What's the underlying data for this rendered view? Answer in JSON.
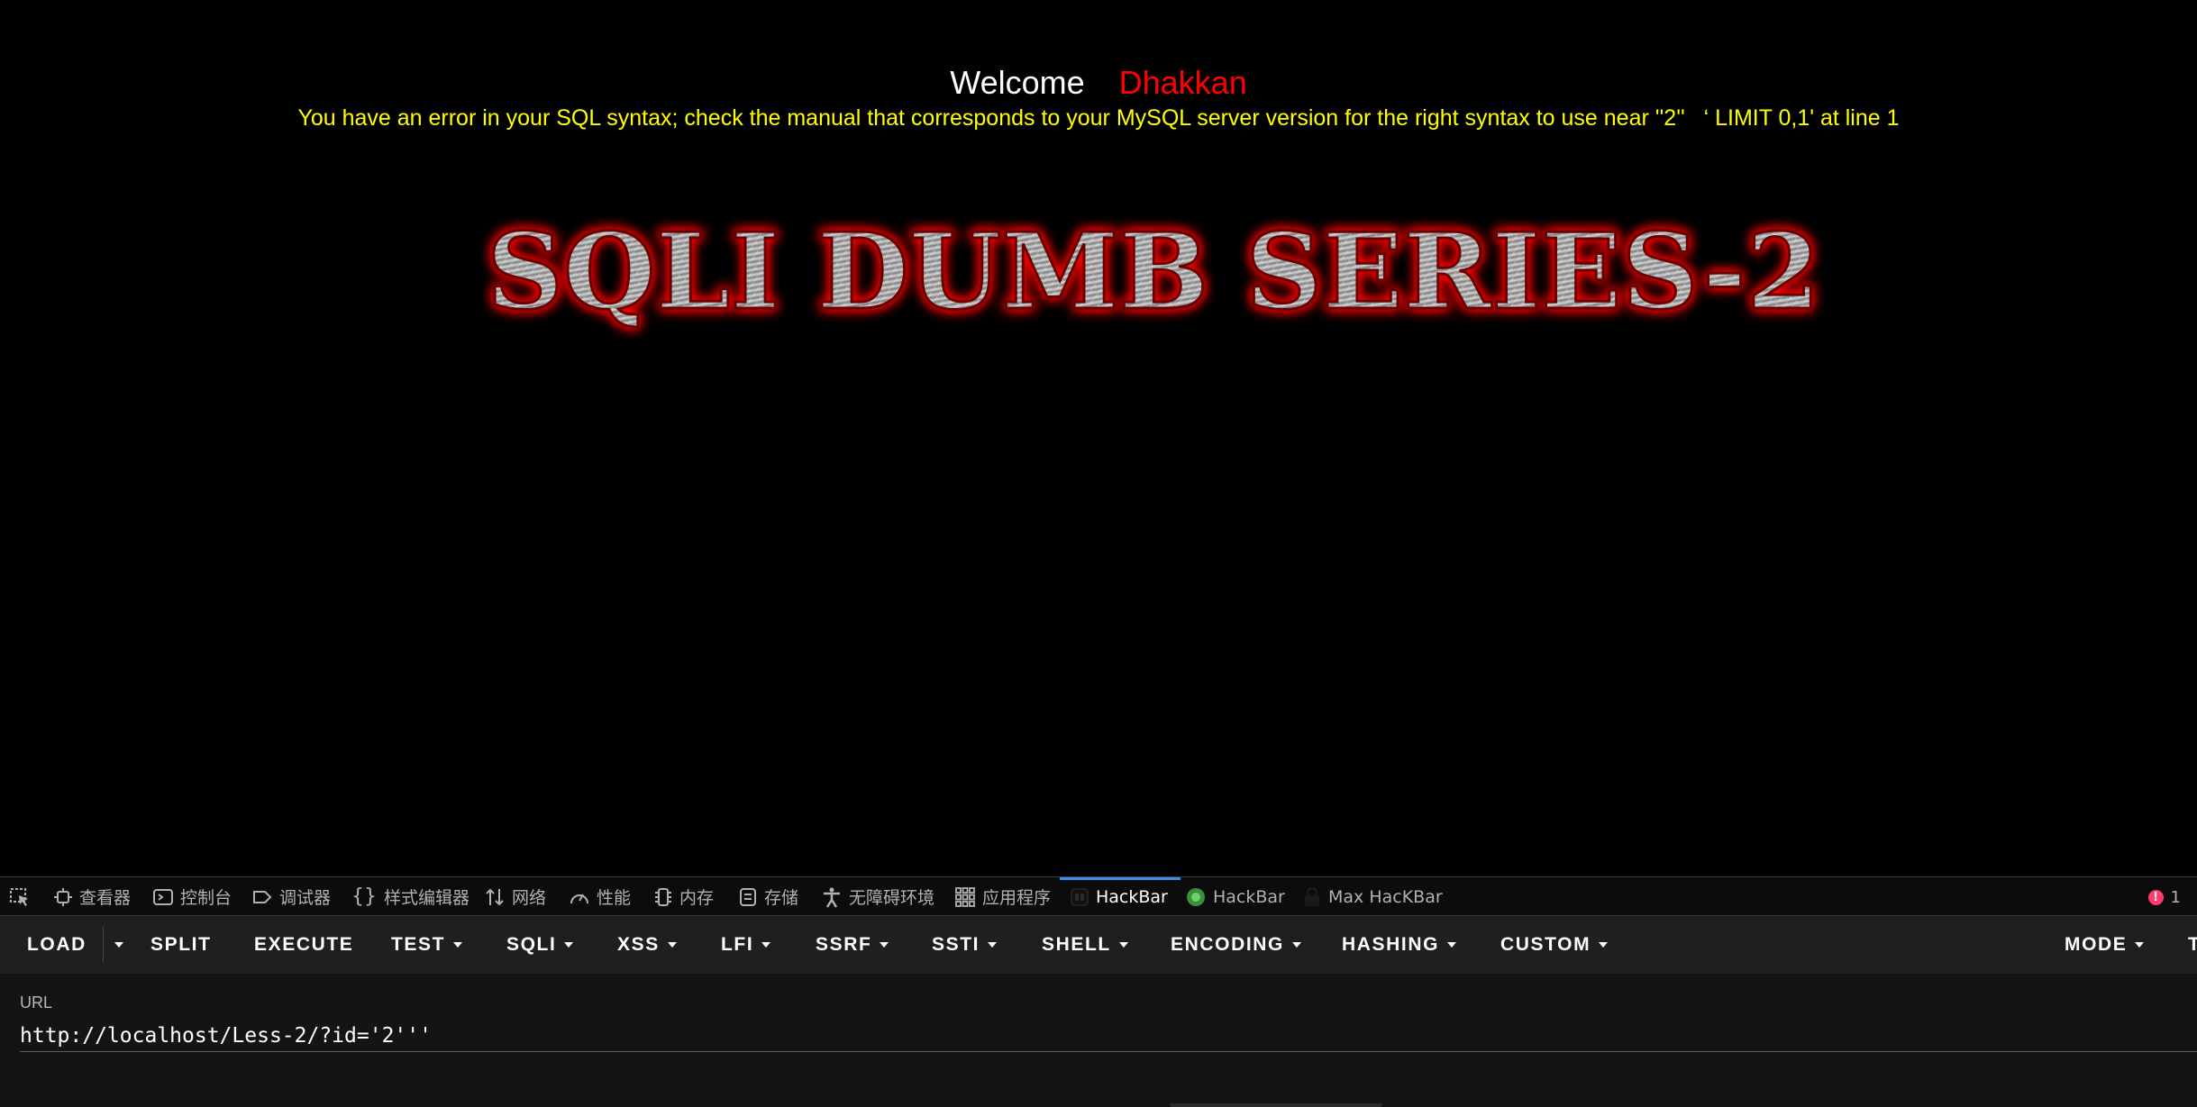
{
  "page": {
    "welcome": "Welcome",
    "username": "Dhakkan",
    "error_message": "You have an error in your SQL syntax; check the manual that corresponds to your MySQL server version for the right syntax to use near ''2''   ‘ LIMIT 0,1' at line 1",
    "banner_title": "SQLI DUMB SERIES-2",
    "colors": {
      "welcome": "#ffffff",
      "username": "#ff0000",
      "error": "#ffff00",
      "banner_glow": "#ff0000",
      "background": "#000000"
    }
  },
  "devtools": {
    "tabs": [
      {
        "label": "",
        "icon": "pick-element-icon"
      },
      {
        "label": "查看器",
        "icon": "inspector-icon"
      },
      {
        "label": "控制台",
        "icon": "console-icon"
      },
      {
        "label": "调试器",
        "icon": "debugger-icon"
      },
      {
        "label": "样式编辑器",
        "icon": "style-editor-icon"
      },
      {
        "label": "网络",
        "icon": "network-icon"
      },
      {
        "label": "性能",
        "icon": "performance-icon"
      },
      {
        "label": "内存",
        "icon": "memory-icon"
      },
      {
        "label": "存储",
        "icon": "storage-icon"
      },
      {
        "label": "无障碍环境",
        "icon": "accessibility-icon"
      },
      {
        "label": "应用程序",
        "icon": "application-icon"
      },
      {
        "label": "HackBar",
        "icon": "hackbar-icon",
        "active": true
      },
      {
        "label": "HackBar",
        "icon": "hackbar-green-icon"
      },
      {
        "label": "Max HacKBar",
        "icon": "max-hackbar-icon"
      }
    ],
    "error_count": "1"
  },
  "hackbar": {
    "buttons": {
      "load": "LOAD",
      "split": "SPLIT",
      "execute": "EXECUTE",
      "test": "TEST",
      "sqli": "SQLI",
      "xss": "XSS",
      "lfi": "LFI",
      "ssrf": "SSRF",
      "ssti": "SSTI",
      "shell": "SHELL",
      "encoding": "ENCODING",
      "hashing": "HASHING",
      "custom": "CUSTOM",
      "mode": "MODE",
      "overflow": "T"
    },
    "url_label": "URL",
    "url_value": "http://localhost/Less-2/?id='2'''"
  }
}
